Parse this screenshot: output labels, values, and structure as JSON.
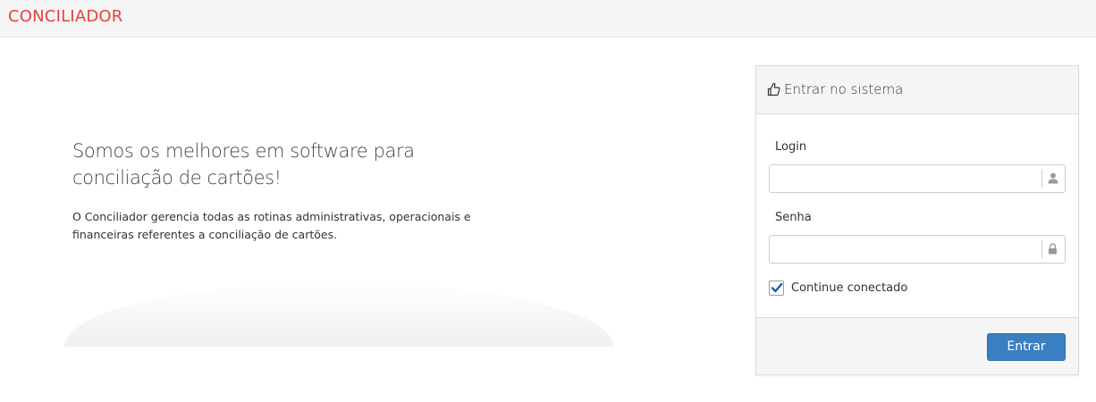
{
  "header": {
    "brand": "CONCILIADOR",
    "brand_color": "#e8413f"
  },
  "hero": {
    "title": "Somos os melhores em software para conciliação de cartões!",
    "description": "O Conciliador gerencia todas as rotinas administrativas, operacionais e financeiras referentes a conciliação de cartões."
  },
  "login_panel": {
    "title": "Entrar no sistema",
    "title_icon": "thumbs-up-icon",
    "login_label": "Login",
    "login_value": "",
    "login_icon": "user-icon",
    "password_label": "Senha",
    "password_value": "",
    "password_icon": "lock-icon",
    "remember_label": "Continue conectado",
    "remember_checked": true,
    "submit_label": "Entrar",
    "accent_color": "#3a7fc1"
  }
}
